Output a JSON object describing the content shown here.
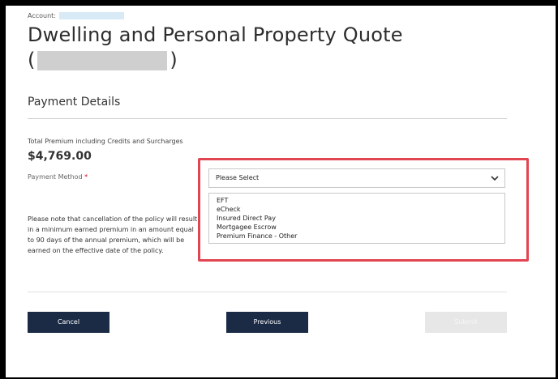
{
  "header": {
    "account_label": "Account:",
    "title_line1": "Dwelling and Personal Property Quote",
    "title_open_paren": "(",
    "title_close_paren": ")"
  },
  "section": {
    "title": "Payment Details"
  },
  "premium": {
    "label": "Total Premium including Credits and Surcharges",
    "amount": "$4,769.00"
  },
  "payment_method": {
    "label": "Payment Method",
    "required_marker": "*",
    "selected": "Please Select",
    "options": [
      "EFT",
      "eCheck",
      "Insured Direct Pay",
      "Mortgagee Escrow",
      "Premium Finance - Other"
    ]
  },
  "note": {
    "text": "Please note that cancellation of the policy will result in a minimum earned premium in an amount equal to 90 days of the annual premium, which will be earned on the effective date of the policy."
  },
  "buttons": {
    "cancel": "Cancel",
    "previous": "Previous",
    "submit": "Submit"
  },
  "colors": {
    "button_primary": "#1b2b46",
    "button_disabled": "#e7e7e7",
    "highlight": "#e24552",
    "required": "#d0021b"
  }
}
